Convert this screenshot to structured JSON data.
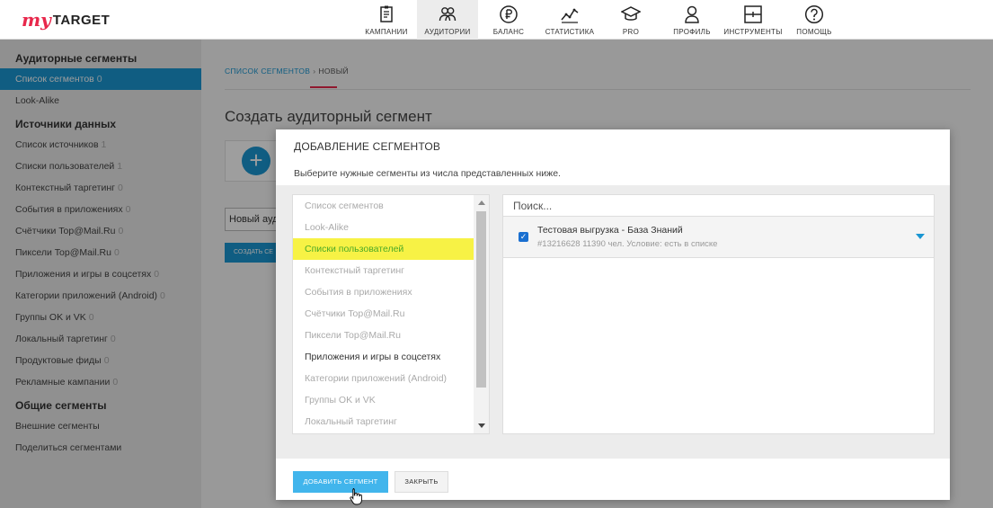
{
  "brand": {
    "my": "my",
    "target": "TARGET"
  },
  "nav": [
    {
      "label": "КАМПАНИИ",
      "icon": "campaigns-icon"
    },
    {
      "label": "АУДИТОРИИ",
      "icon": "audiences-icon"
    },
    {
      "label": "БАЛАНС",
      "icon": "ruble-icon"
    },
    {
      "label": "СТАТИСТИКА",
      "icon": "statistics-icon"
    },
    {
      "label": "PRO",
      "icon": "graduation-cap-icon"
    },
    {
      "label": "ПРОФИЛЬ",
      "icon": "profile-icon"
    },
    {
      "label": "ИНСТРУМЕНТЫ",
      "icon": "tools-icon"
    },
    {
      "label": "ПОМОЩЬ",
      "icon": "help-icon"
    }
  ],
  "sidebar": {
    "audience_head": "Аудиторные сегменты",
    "audience_items": [
      {
        "label": "Список сегментов",
        "count": "0"
      },
      {
        "label": "Look-Alike",
        "count": ""
      }
    ],
    "sources_head": "Источники данных",
    "sources_items": [
      {
        "label": "Список источников",
        "count": "1"
      },
      {
        "label": "Списки пользователей",
        "count": "1"
      },
      {
        "label": "Контекстный таргетинг",
        "count": "0"
      },
      {
        "label": "События в приложениях",
        "count": "0"
      },
      {
        "label": "Счётчики Top@Mail.Ru",
        "count": "0"
      },
      {
        "label": "Пиксели Top@Mail.Ru",
        "count": "0"
      },
      {
        "label": "Приложения и игры в соцсетях",
        "count": "0"
      },
      {
        "label": "Категории приложений (Android)",
        "count": "0"
      },
      {
        "label": "Группы OK и VK",
        "count": "0"
      },
      {
        "label": "Локальный таргетинг",
        "count": "0"
      },
      {
        "label": "Продуктовые фиды",
        "count": "0"
      },
      {
        "label": "Рекламные кампании",
        "count": "0"
      }
    ],
    "common_head": "Общие сегменты",
    "common_items": [
      {
        "label": "Внешние сегменты"
      },
      {
        "label": "Поделиться сегментами"
      }
    ]
  },
  "main": {
    "breadcrumb_link": "СПИСОК СЕГМЕНТОВ",
    "breadcrumb_sep": "›",
    "breadcrumb_current": "НОВЫЙ",
    "title": "Создать аудиторный сегмент",
    "name_input_value": "Новый ауд",
    "create_button": "СОЗДАТЬ СЕ"
  },
  "modal": {
    "title": "ДОБАВЛЕНИЕ СЕГМЕНТОВ",
    "subtitle": "Выберите нужные сегменты из числа представленных ниже.",
    "list": [
      "Список сегментов",
      "Look-Alike",
      "Списки пользователей",
      "Контекстный таргетинг",
      "События в приложениях",
      "Счётчики Top@Mail.Ru",
      "Пиксели Top@Mail.Ru",
      "Приложения и игры в соцсетях",
      "Категории приложений (Android)",
      "Группы OK и VK",
      "Локальный таргетинг"
    ],
    "search_placeholder": "Поиск...",
    "segment": {
      "name": "Тестовая выгрузка - База Знаний",
      "meta": "#13216628  11390 чел.  Условие: есть в списке"
    },
    "add_button": "ДОБАВИТЬ СЕГМЕНТ",
    "close_button": "ЗАКРЫТЬ"
  }
}
